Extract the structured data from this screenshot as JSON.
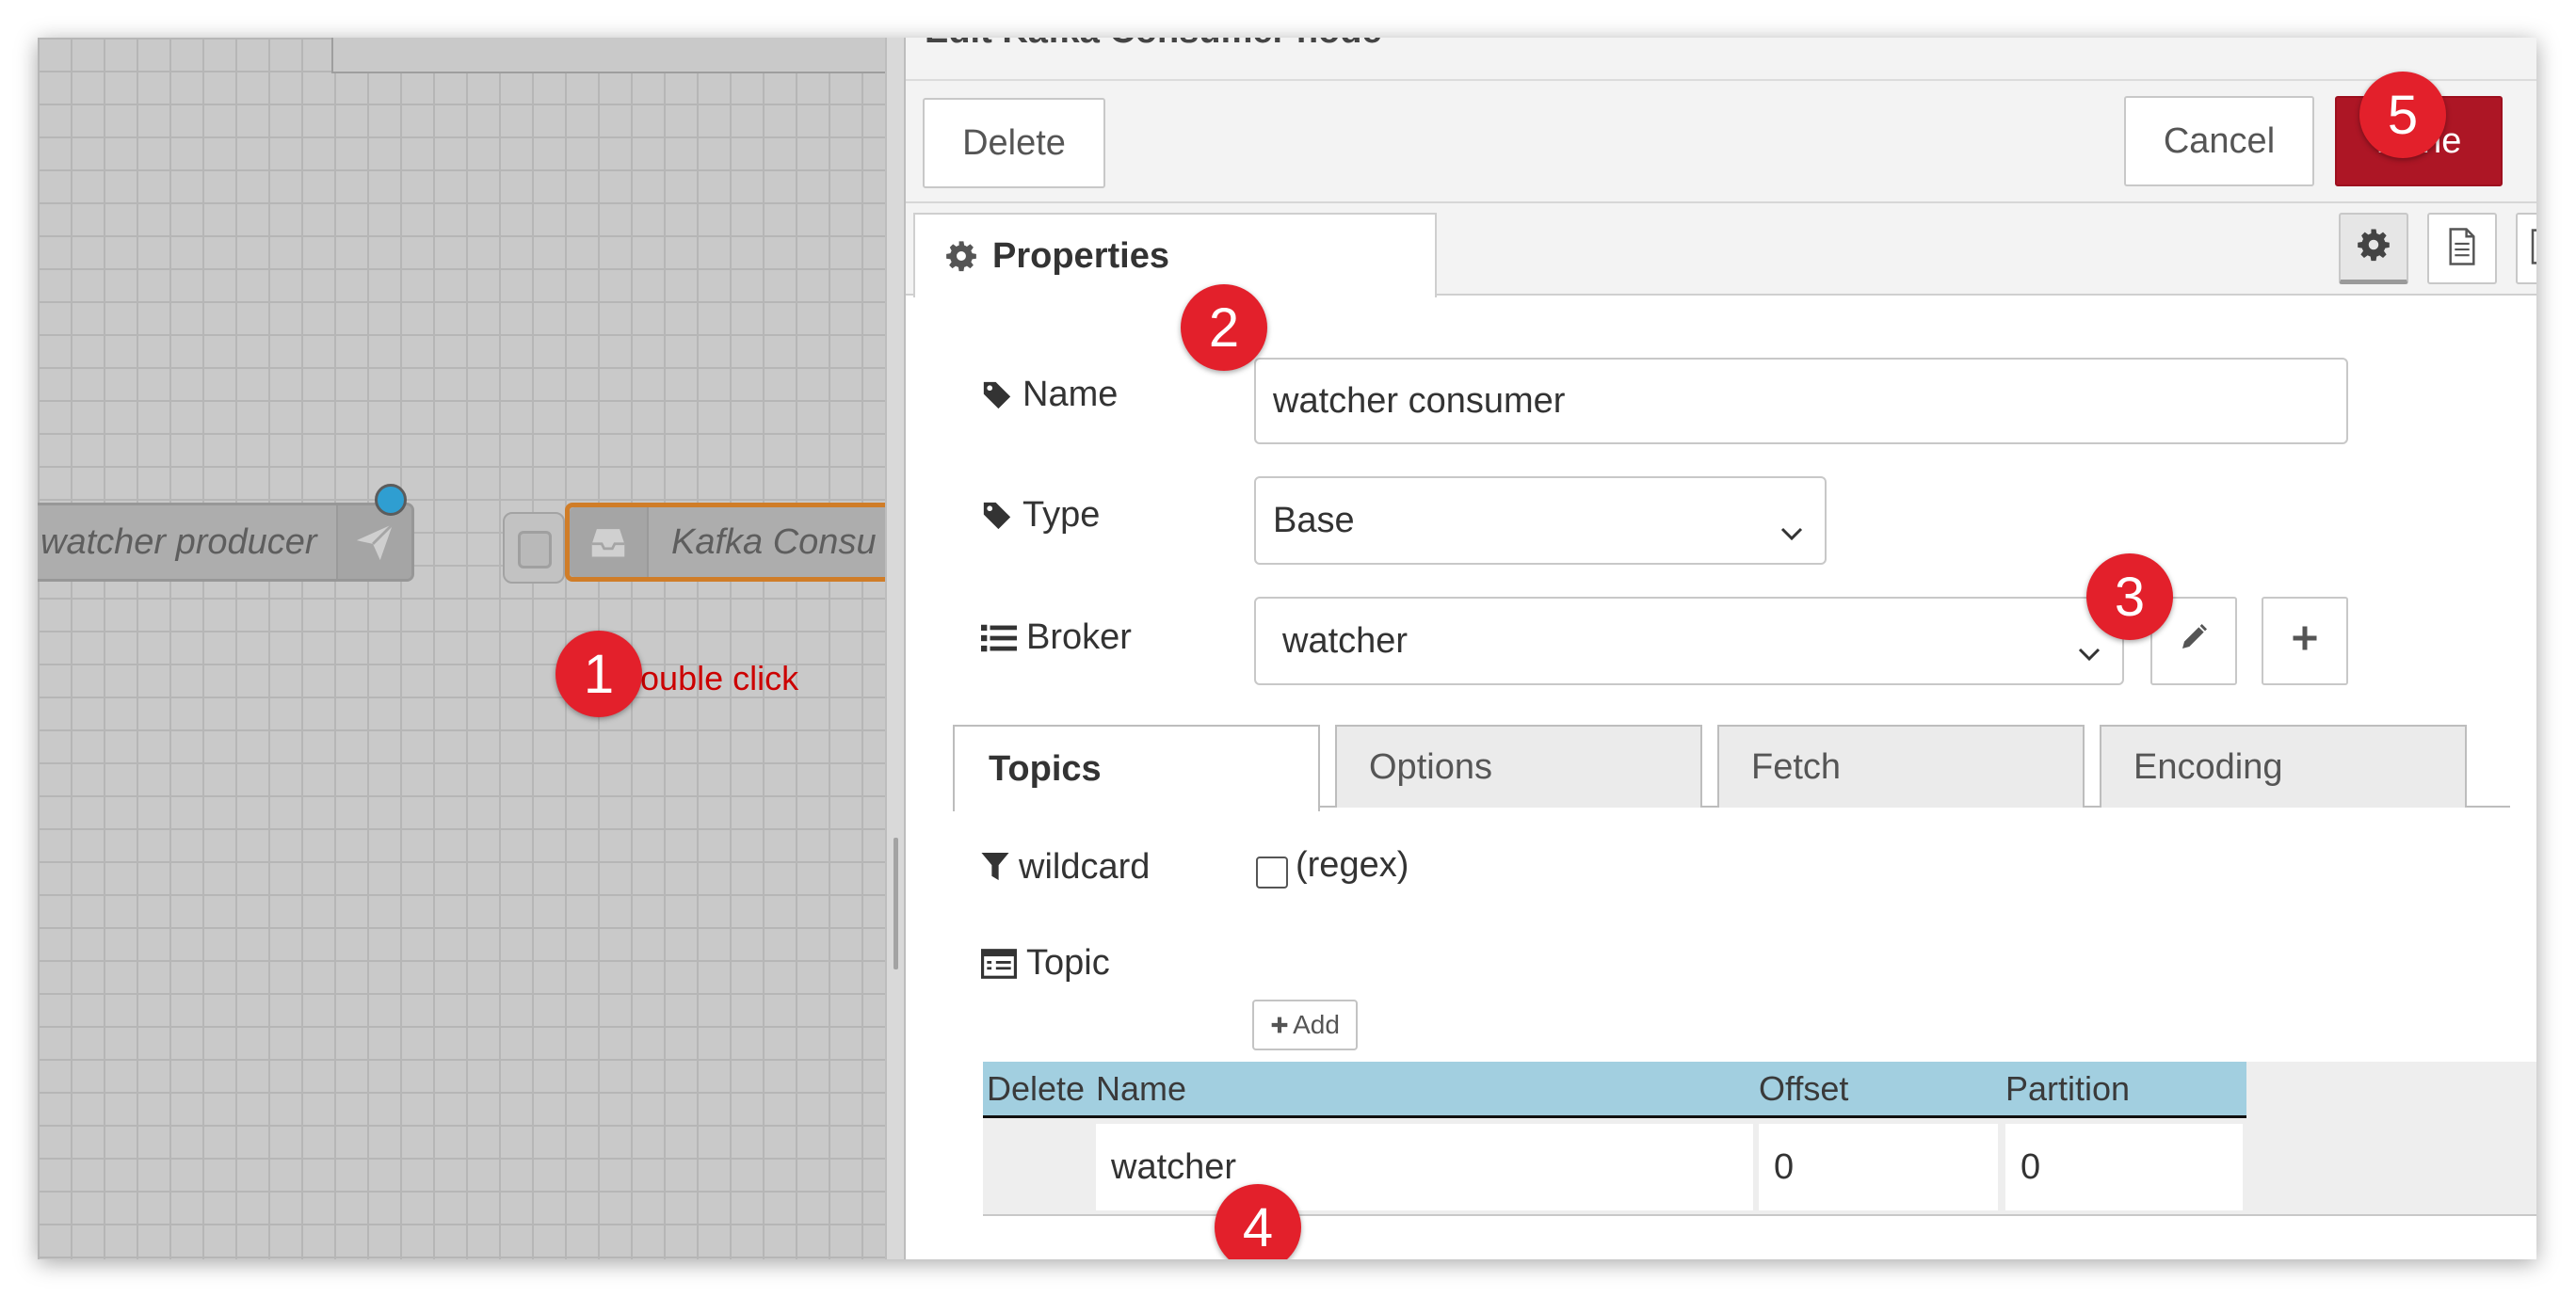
{
  "workspace": {
    "producer_node_label": "watcher producer",
    "consumer_node_label": "Kafka Consu",
    "hint_text": "double click"
  },
  "editor": {
    "title": "Edit Kafka Consumer node",
    "delete_label": "Delete",
    "cancel_label": "Cancel",
    "done_label": "Done",
    "properties_tab_label": "Properties",
    "name": {
      "label": "Name",
      "value": "watcher consumer"
    },
    "type": {
      "label": "Type",
      "value": "Base"
    },
    "broker": {
      "label": "Broker",
      "value": "watcher"
    },
    "subtabs": [
      {
        "label": "Topics",
        "active": true
      },
      {
        "label": "Options",
        "active": false
      },
      {
        "label": "Fetch",
        "active": false
      },
      {
        "label": "Encoding",
        "active": false
      }
    ],
    "wildcard": {
      "label": "wildcard",
      "checkbox_text": "(regex)",
      "checked": false
    },
    "topic": {
      "label": "Topic",
      "add_label": "Add",
      "columns": [
        "Delete",
        "Name",
        "Offset",
        "Partition"
      ],
      "rows": [
        {
          "name": "watcher",
          "offset": "0",
          "partition": "0"
        }
      ]
    }
  },
  "annotations": [
    "1",
    "2",
    "3",
    "4",
    "5"
  ],
  "colors": {
    "done_button": "#ad1625",
    "badge": "#e3202b",
    "selected_node_border": "#d07d28",
    "table_header": "#a2cfe0",
    "hint_text": "#cc0000",
    "port": "#2f9ed1"
  },
  "icons": [
    "paper-plane-icon",
    "inbox-icon",
    "gear-icon",
    "tag-icon",
    "list-icon",
    "filter-icon",
    "table-icon",
    "pencil-icon",
    "plus-icon",
    "chevron-down-icon",
    "document-icon",
    "frame-icon"
  ]
}
